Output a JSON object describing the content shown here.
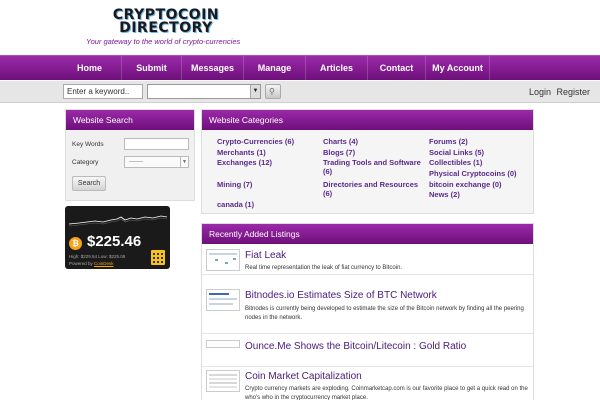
{
  "header": {
    "logo_line1": "CRYPTOCOIN",
    "logo_line2": "DIRECTORY",
    "tagline": "Your gateway to the world of crypto-currencies"
  },
  "nav": {
    "items": [
      {
        "label": "Home"
      },
      {
        "label": "Submit"
      },
      {
        "label": "Messages"
      },
      {
        "label": "Manage"
      },
      {
        "label": "Articles"
      },
      {
        "label": "Contact"
      },
      {
        "label": "My Account"
      }
    ]
  },
  "search_bar": {
    "keyword_value": "Enter a keyword..",
    "category_value": ""
  },
  "auth": {
    "login": "Login",
    "register": "Register"
  },
  "website_search": {
    "title": "Website Search",
    "keywords_label": "Key Words",
    "category_label": "Category",
    "category_value": "-------",
    "search_button": "Search"
  },
  "ticker": {
    "price": "$225.46",
    "high_low": "High: $229.54   Low: $225.08",
    "powered_by": "Powered by",
    "provider": "CoinDesk"
  },
  "categories": {
    "title": "Website Categories",
    "items": [
      {
        "label": "Crypto-Currencies (6)"
      },
      {
        "label": "Merchants (1)"
      },
      {
        "label": "Exchanges (12)"
      },
      {
        "label": "Mining (7)"
      },
      {
        "label": "canada (1)"
      },
      {
        "label": "Charts (4)"
      },
      {
        "label": "Blogs (7)"
      },
      {
        "label": "Trading Tools and Software (6)"
      },
      {
        "label": "Directories and Resources (6)"
      },
      {
        "label": "Forums (2)"
      },
      {
        "label": "Social Links (5)"
      },
      {
        "label": "Collectibles (1)"
      },
      {
        "label": "Physical Cryptocoins (0)"
      },
      {
        "label": "bitcoin exchange (0)"
      },
      {
        "label": "News (2)"
      }
    ]
  },
  "recent": {
    "title": "Recently Added Listings",
    "items": [
      {
        "title": "Fiat Leak",
        "desc": "Real time representation the leak of fiat currency to Bitcoin."
      },
      {
        "title": "Bitnodes.io Estimates Size of BTC Network",
        "desc": "Bitnodes is currently being developed to estimate the size of the Bitcoin network by finding all the peering nodes in the network."
      },
      {
        "title": "Ounce.Me Shows the Bitcoin/Litecoin : Gold Ratio",
        "desc": ""
      },
      {
        "title": "Coin Market Capitalization",
        "desc": "Crypto currency markets are exploding. Coinmarketcap.com is our favorite place to get a quick read on the who's who in the cryptocurrency market place."
      }
    ]
  },
  "colors": {
    "brand_purple": "#7e1a8c",
    "link_purple": "#5a2a8a",
    "bitcoin_orange": "#f7a21b"
  }
}
